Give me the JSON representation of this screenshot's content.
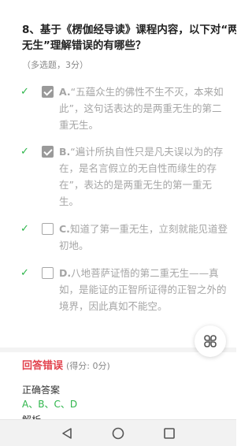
{
  "question": {
    "number": "8、",
    "title": "基于《楞伽经导读》课程内容，以下对“两重无生”理解错误的有哪些？",
    "meta": "（多选题，3分）"
  },
  "options": [
    {
      "letter": "A.",
      "text": "“五蕴众生的佛性不生不灭，本来如此”，这句话表达的是两重无生的第二重无生。",
      "checked": true,
      "correct": true
    },
    {
      "letter": "B.",
      "text": "“遍计所执自性只是凡夫误以为的存在，是名言假立的无自性而缘生的存在”，表达的是两重无生的第一重无生。",
      "checked": true,
      "correct": true
    },
    {
      "letter": "C.",
      "text": "知道了第一重无生，立刻就能见道登初地。",
      "checked": false,
      "correct": true
    },
    {
      "letter": "D.",
      "text": "八地菩萨证悟的第二重无生——真如，是能证的正智所证得的正智之外的境界，因此真如不能空。",
      "checked": false,
      "correct": true
    }
  ],
  "result": {
    "status": "回答错误",
    "score": "(得分: 0分)"
  },
  "answer": {
    "label": "正确答案",
    "value": "A、B、C、D"
  },
  "analysis": {
    "label": "解析"
  },
  "colors": {
    "correct_green": "#2db54a",
    "wrong_red": "#e2424d",
    "muted_text": "#a5a5a5"
  },
  "icons": {
    "fab": "grid-menu-icon",
    "nav_back": "back-triangle-icon",
    "nav_home": "home-circle-icon",
    "nav_recent": "recent-square-icon"
  }
}
